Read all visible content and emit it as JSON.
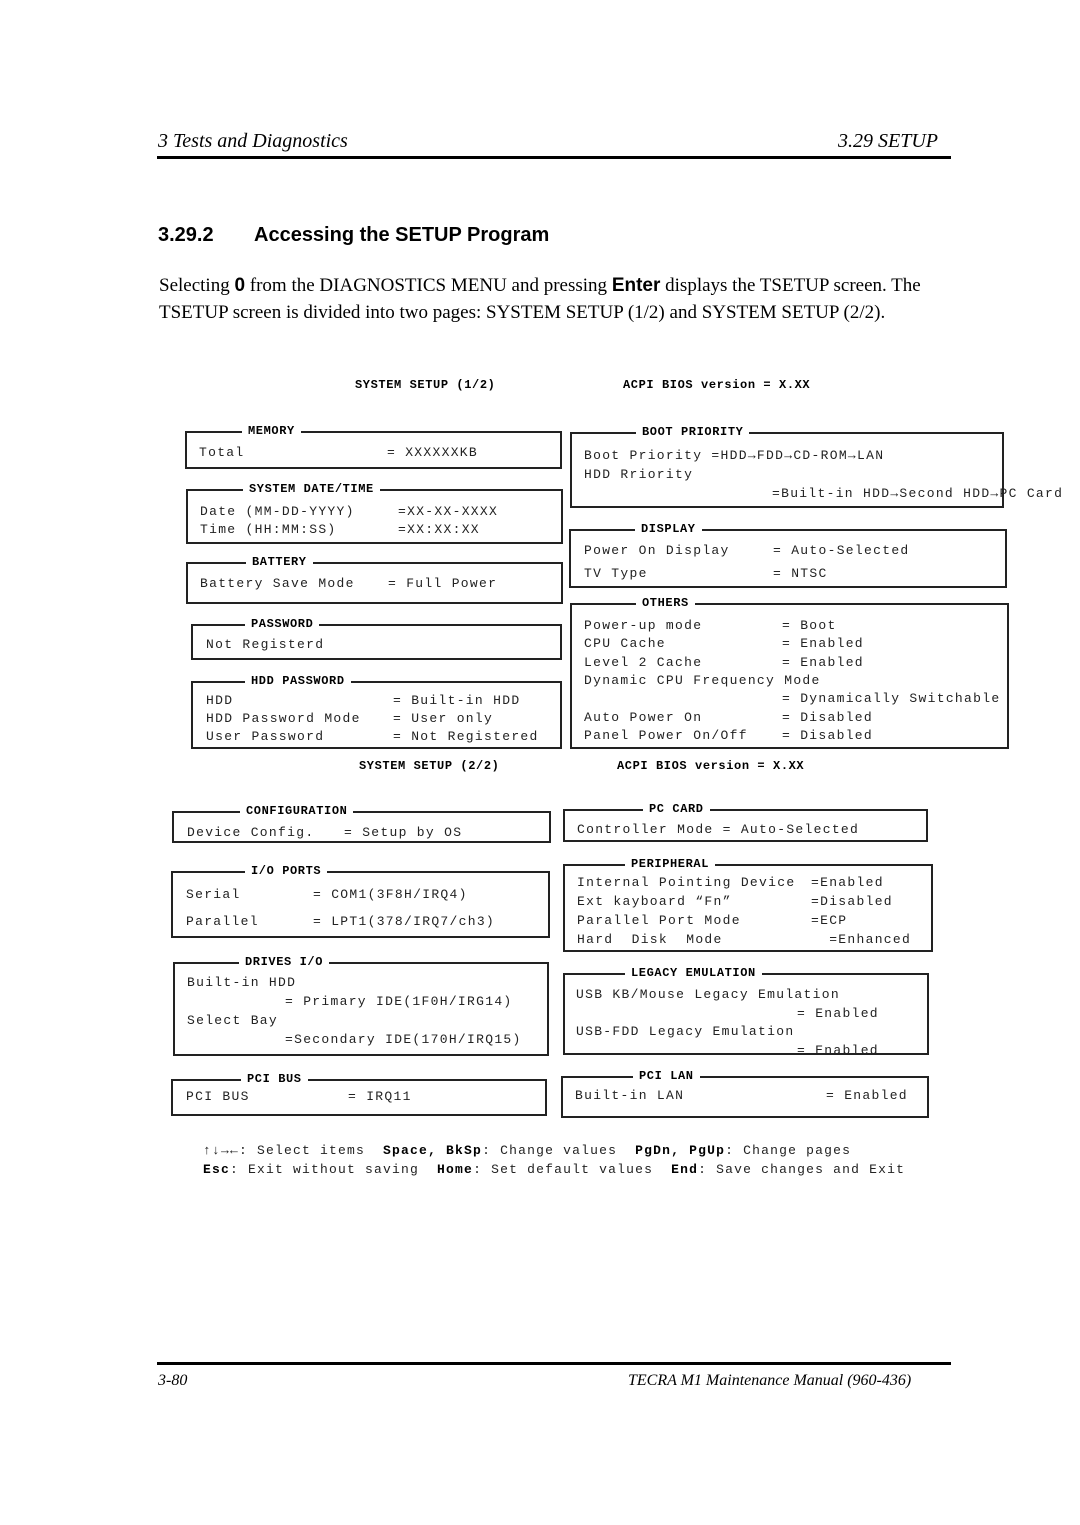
{
  "header": {
    "chapter": "3  Tests and Diagnostics",
    "section": "3.29  SETUP"
  },
  "heading": {
    "number": "3.29.2",
    "title": "Accessing the SETUP Program"
  },
  "paragraph": {
    "p1": "Selecting ",
    "key0": "0",
    "p2": " from the DIAGNOSTICS MENU and pressing ",
    "keyEnter": "Enter",
    "p3": " displays the TSETUP screen. The TSETUP screen is divided into two pages: SYSTEM SETUP (1/2) and SYSTEM SETUP (2/2)."
  },
  "page1": {
    "title": "SYSTEM SETUP  (1/2)",
    "bios": "ACPI BIOS version = X.XX"
  },
  "page2": {
    "title": "SYSTEM SETUP  (2/2)",
    "bios": "ACPI BIOS version = X.XX"
  },
  "boxes": [
    {
      "id": "memory",
      "legend": "MEMORY",
      "rows": [
        [
          "Total",
          "= XXXXXXKB"
        ]
      ]
    },
    {
      "id": "datetime",
      "legend": "SYSTEM DATE/TIME",
      "rows": [
        [
          "Date (MM-DD-YYYY)",
          "=XX-XX-XXXX"
        ],
        [
          "Time (HH:MM:SS)",
          "=XX:XX:XX"
        ]
      ]
    },
    {
      "id": "battery",
      "legend": "BATTERY",
      "rows": [
        [
          "Battery Save Mode",
          "= Full Power"
        ]
      ]
    },
    {
      "id": "password",
      "legend": "PASSWORD",
      "rows": [
        [
          "Not Registerd",
          ""
        ]
      ]
    },
    {
      "id": "hddpw",
      "legend": "HDD PASSWORD",
      "rows": [
        [
          "HDD",
          "= Built-in HDD"
        ],
        [
          "HDD Password Mode",
          "= User only"
        ],
        [
          "User Password",
          "= Not Registered"
        ]
      ]
    },
    {
      "id": "boot",
      "legend": "BOOT PRIORITY",
      "rows": [
        [
          "Boot Priority =HDD→FDD→CD-ROM→LAN",
          ""
        ],
        [
          "HDD Rriority",
          ""
        ],
        [
          "",
          "=Built-in HDD→Second HDD→PC Card"
        ]
      ]
    },
    {
      "id": "display",
      "legend": "DISPLAY",
      "rows": [
        [
          "Power On Display",
          "= Auto-Selected"
        ],
        [
          "TV Type",
          "= NTSC"
        ]
      ]
    },
    {
      "id": "others",
      "legend": "OTHERS",
      "rows": [
        [
          "Power-up mode",
          "= Boot"
        ],
        [
          "CPU Cache",
          "= Enabled"
        ],
        [
          "Level 2 Cache",
          "= Enabled"
        ],
        [
          "Dynamic CPU Frequency Mode",
          ""
        ],
        [
          "",
          "= Dynamically Switchable"
        ],
        [
          "Auto Power On",
          "= Disabled"
        ],
        [
          "Panel Power On/Off",
          "= Disabled"
        ]
      ]
    },
    {
      "id": "config",
      "legend": "CONFIGURATION",
      "rows": [
        [
          "Device Config.",
          "= Setup by OS"
        ]
      ]
    },
    {
      "id": "ioports",
      "legend": "I/O PORTS",
      "rows": [
        [
          "Serial",
          "= COM1(3F8H/IRQ4)"
        ],
        [
          "Parallel",
          "= LPT1(378/IRQ7/ch3)"
        ]
      ]
    },
    {
      "id": "drives",
      "legend": "DRIVES I/O",
      "rows": [
        [
          "Built-in HDD",
          ""
        ],
        [
          "",
          "= Primary IDE(1F0H/IRG14)"
        ],
        [
          "Select Bay",
          ""
        ],
        [
          "",
          "=Secondary IDE(170H/IRQ15)"
        ]
      ]
    },
    {
      "id": "pcibus",
      "legend": "PCI BUS",
      "rows": [
        [
          "PCI BUS",
          "= IRQ11"
        ]
      ]
    },
    {
      "id": "pccard",
      "legend": "PC CARD",
      "rows": [
        [
          "Controller Mode = Auto-Selected",
          ""
        ]
      ]
    },
    {
      "id": "peripheral",
      "legend": "PERIPHERAL",
      "rows": [
        [
          "Internal Pointing Device",
          "=Enabled"
        ],
        [
          "Ext kayboard “Fn”",
          "=Disabled"
        ],
        [
          "Parallel Port Mode",
          "=ECP"
        ],
        [
          "Hard  Disk  Mode",
          "  =Enhanced"
        ]
      ]
    },
    {
      "id": "legacy",
      "legend": "LEGACY EMULATION",
      "rows": [
        [
          "USB KB/Mouse Legacy Emulation",
          ""
        ],
        [
          "",
          "= Enabled"
        ],
        [
          "USB-FDD Legacy Emulation",
          ""
        ],
        [
          "",
          "= Enabled"
        ]
      ]
    },
    {
      "id": "pcilan",
      "legend": "PCI LAN",
      "rows": [
        [
          "Built-in LAN",
          "= Enabled"
        ]
      ]
    }
  ],
  "help": {
    "arrows": "↑↓→←",
    "arrows_text": ": Select items  ",
    "space": "Space, BkSp",
    "space_text": ": Change values  ",
    "pg": "PgDn, PgUp",
    "pg_text": ": Change pages",
    "esc": "Esc",
    "esc_text": ": Exit without saving  ",
    "home": "Home",
    "home_text": ": Set default values  ",
    "end": "End",
    "end_text": ": Save changes and Exit"
  },
  "footer": {
    "page": "3-80",
    "manual": "TECRA M1  Maintenance Manual (960-436)"
  }
}
